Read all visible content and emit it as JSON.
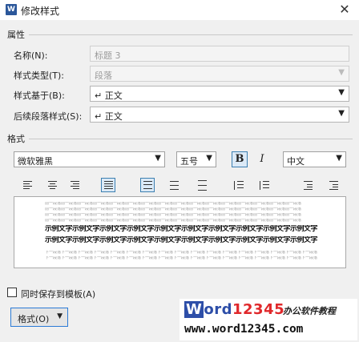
{
  "window": {
    "title": "修改样式",
    "app_icon_letter": "W",
    "close_glyph": "✕"
  },
  "properties": {
    "section_label": "属性",
    "name": {
      "label": "名称(N):",
      "value": "标题 3"
    },
    "style_type": {
      "label": "样式类型(T):",
      "value": "段落"
    },
    "based_on": {
      "label": "样式基于(B):",
      "value": "↵ 正文"
    },
    "following_style": {
      "label": "后续段落样式(S):",
      "value": "↵ 正文"
    }
  },
  "format": {
    "section_label": "格式",
    "font": "微软雅黑",
    "size": "五号",
    "bold_label": "B",
    "italic_label": "I",
    "script": "中文",
    "bold_pressed": true
  },
  "preview": {
    "prev_para": "前一段落前一段落前一段落前一段落前一段落前一段落前一段落前一段落前一段落前一段落前一段落前一段落前一段落前一段落前一段落前一段落",
    "sample_text": "示例文字示例文字示例文字示例文字示例文字示例文字示例文字示例文字示例文字示例文字示例文字示例文字示例文字示例文字示例文字示例文字示例文字示例文字",
    "next_para": "下一段落下一段落下一段落下一段落下一段落下一段落下一段落下一段落下一段落下一段落下一段落下一段落下一段落下一段落下一段落下一段落下一段落下一段落"
  },
  "add_to_template_label": "同时保存到模板(A)",
  "format_button_label": "格式(O)",
  "watermark": {
    "w": "W",
    "rest": "ord",
    "num": "12345",
    "sub": "办公软件教程",
    "url": "www.word12345.com"
  }
}
